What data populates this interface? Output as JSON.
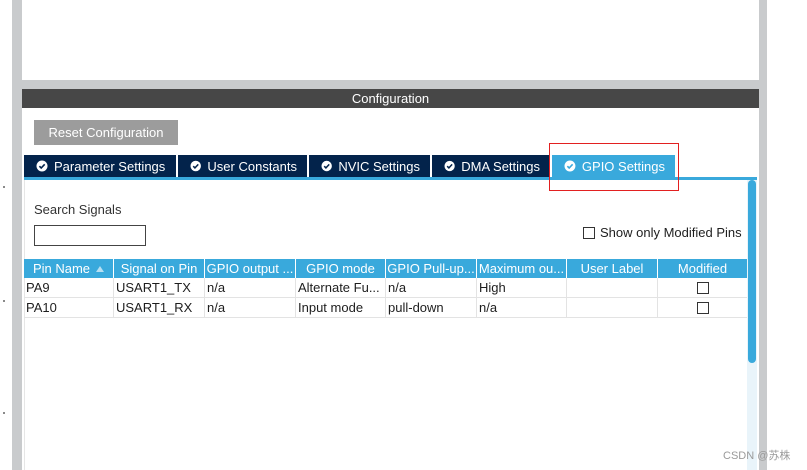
{
  "configuration": {
    "header_title": "Configuration",
    "reset_button_label": "Reset Configuration",
    "tabs": [
      {
        "label": "Parameter Settings",
        "icon": "check-circle-icon",
        "active": false
      },
      {
        "label": "User Constants",
        "icon": "check-circle-icon",
        "active": false
      },
      {
        "label": "NVIC Settings",
        "icon": "check-circle-icon",
        "active": false
      },
      {
        "label": "DMA Settings",
        "icon": "check-circle-icon",
        "active": false
      },
      {
        "label": "GPIO Settings",
        "icon": "check-circle-icon",
        "active": true
      }
    ]
  },
  "gpio": {
    "search_label": "Search Signals",
    "search_value": "",
    "show_modified_label": "Show only Modified Pins",
    "show_modified_checked": false,
    "columns": [
      "Pin Name",
      "Signal on Pin",
      "GPIO output ...",
      "GPIO mode",
      "GPIO Pull-up...",
      "Maximum ou...",
      "User Label",
      "Modified"
    ],
    "rows": [
      {
        "pin": "PA9",
        "signal": "USART1_TX",
        "output": "n/a",
        "mode": "Alternate Fu...",
        "pull": "n/a",
        "speed": "High",
        "label": "",
        "modified": false
      },
      {
        "pin": "PA10",
        "signal": "USART1_RX",
        "output": "n/a",
        "mode": "Input mode",
        "pull": "pull-down",
        "speed": "n/a",
        "label": "",
        "modified": false
      }
    ]
  },
  "watermark": "CSDN @苏株",
  "colors": {
    "accent": "#39a9dc",
    "tab_dark": "#03234b",
    "header_bg": "#474747",
    "button_bg": "#9c9c9c",
    "highlight": "#e22020"
  }
}
